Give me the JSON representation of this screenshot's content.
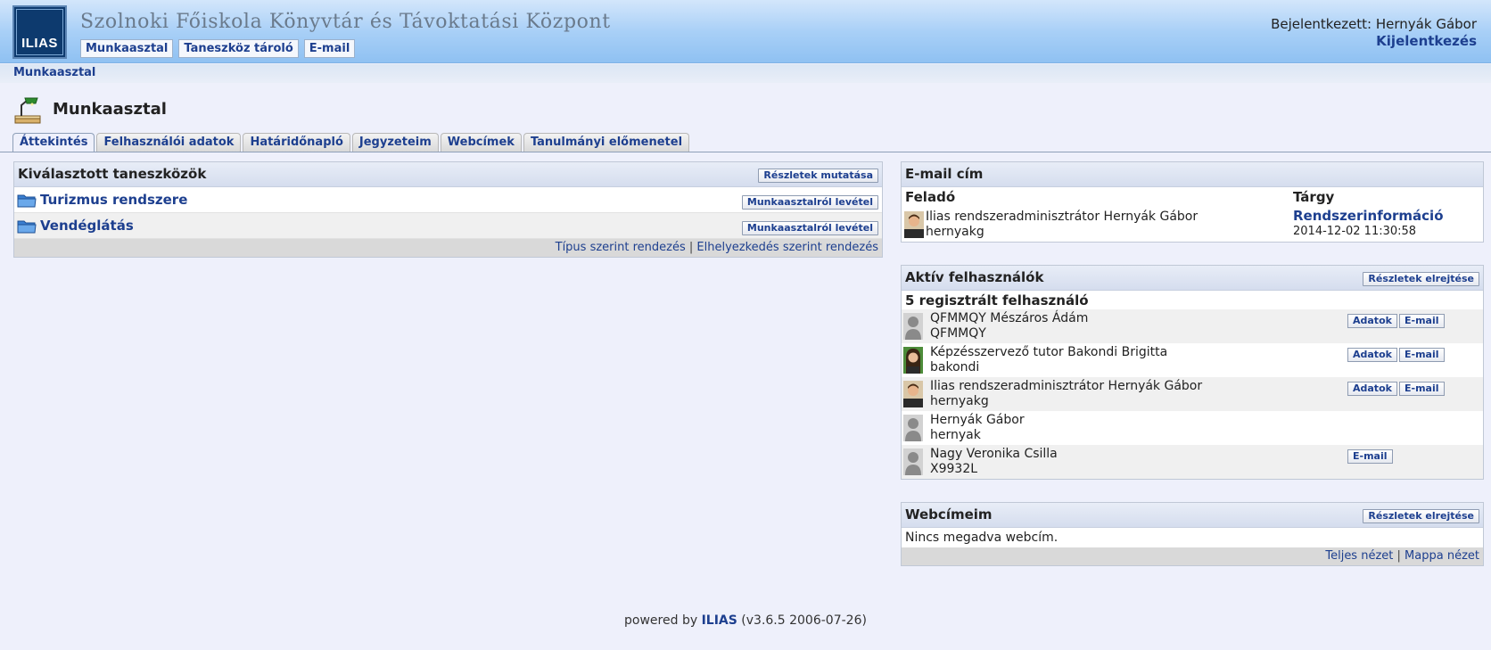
{
  "header": {
    "logo_text": "ILIAS",
    "institution": "Szolnoki Főiskola Könyvtár és Távoktatási Központ",
    "menu": [
      {
        "label": "Munkaasztal"
      },
      {
        "label": "Taneszköz tároló"
      },
      {
        "label": "E-mail"
      }
    ],
    "logged_in": "Bejelentkezett: Hernyák Gábor",
    "logout": "Kijelentkezés"
  },
  "locator": {
    "label": "Munkaasztal"
  },
  "page": {
    "title": "Munkaasztal",
    "icon": "desk-lamp-icon"
  },
  "tabs": [
    {
      "label": "Áttekintés",
      "active": true
    },
    {
      "label": "Felhasználói adatok"
    },
    {
      "label": "Határidőnapló"
    },
    {
      "label": "Jegyzeteim"
    },
    {
      "label": "Webcímek"
    },
    {
      "label": "Tanulmányi előmenetel"
    }
  ],
  "selected_items": {
    "title": "Kiválasztott taneszközök",
    "details_button": "Részletek mutatása",
    "items": [
      {
        "title": "Turizmus rendszere",
        "remove": "Munkaasztalról levétel",
        "icon": "folder-icon"
      },
      {
        "title": "Vendéglátás",
        "remove": "Munkaasztalról levétel",
        "icon": "folder-icon"
      }
    ],
    "sort_by_type": "Típus szerint rendezés",
    "separator": "|",
    "sort_by_location": "Elhelyezkedés szerint rendezés"
  },
  "mail": {
    "title": "E-mail cím",
    "col_sender": "Feladó",
    "col_subject": "Tárgy",
    "rows": [
      {
        "sender_name": "Ilias rendszeradminisztrátor Hernyák Gábor",
        "sender_login": "hernyakg",
        "subject": "Rendszerinformáció",
        "date": "2014-12-02 11:30:58"
      }
    ]
  },
  "active_users": {
    "title": "Aktív felhasználók",
    "hide_button": "Részletek elrejtése",
    "count_label": "5 regisztrált felhasználó",
    "users": [
      {
        "name": "QFMMQY Mészáros Ádám",
        "login": "QFMMQY",
        "avatar": "default-avatar",
        "buttons": [
          "Adatok",
          "E-mail"
        ]
      },
      {
        "name": "Képzésszervező tutor Bakondi Brigitta",
        "login": "bakondi",
        "avatar": "photo-avatar-woman",
        "buttons": [
          "Adatok",
          "E-mail"
        ]
      },
      {
        "name": "Ilias rendszeradminisztrátor Hernyák Gábor",
        "login": "hernyakg",
        "avatar": "photo-avatar-man",
        "buttons": [
          "Adatok",
          "E-mail"
        ]
      },
      {
        "name": "Hernyák Gábor",
        "login": "hernyak",
        "avatar": "default-avatar",
        "buttons": []
      },
      {
        "name": "Nagy Veronika Csilla",
        "login": "X9932L",
        "avatar": "default-avatar",
        "buttons": [
          "E-mail"
        ]
      }
    ]
  },
  "bookmarks": {
    "title": "Webcímeim",
    "hide_button": "Részletek elrejtése",
    "empty": "Nincs megadva webcím.",
    "full_view": "Teljes nézet",
    "separator": "|",
    "folder_view": "Mappa nézet"
  },
  "footer": {
    "prefix": "powered by",
    "brand": "ILIAS",
    "version": "(v3.6.5 2006-07-26)"
  }
}
